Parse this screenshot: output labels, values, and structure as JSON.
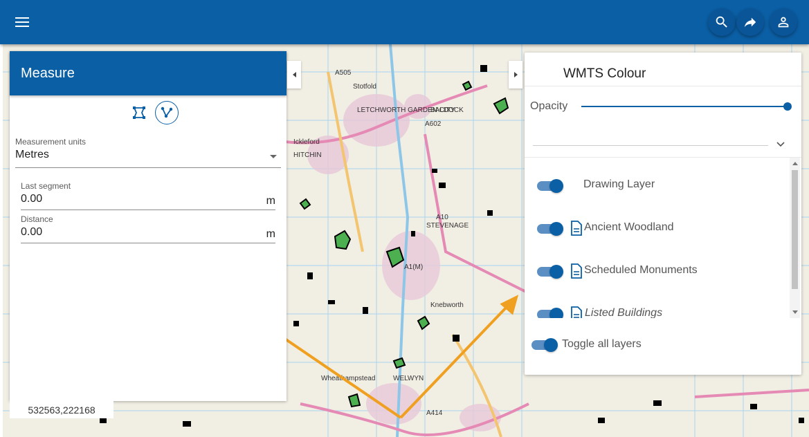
{
  "topbar": {
    "icons": [
      "menu-icon",
      "search-icon",
      "share-icon",
      "account-icon"
    ],
    "bg_color": "#0b5fa5"
  },
  "measure": {
    "title": "Measure",
    "tools": [
      "area-measure-icon",
      "distance-measure-icon"
    ],
    "units_label": "Measurement units",
    "units_value": "Metres",
    "last_segment_label": "Last segment",
    "last_segment_value": "0.00",
    "distance_label": "Distance",
    "distance_value": "0.00",
    "unit_suffix": "m"
  },
  "coordinates": "532563,222168",
  "layers_panel": {
    "title": "WMTS Colour",
    "opacity_label": "Opacity",
    "opacity_value": 1.0,
    "layers": [
      {
        "name": "Drawing Layer",
        "enabled": true,
        "has_doc_icon": false
      },
      {
        "name": "Ancient Woodland",
        "enabled": true,
        "has_doc_icon": true
      },
      {
        "name": "Scheduled Monuments",
        "enabled": true,
        "has_doc_icon": true
      },
      {
        "name": "Listed Buildings",
        "enabled": true,
        "has_doc_icon": true
      }
    ],
    "toggle_all_label": "Toggle all layers"
  },
  "map_labels": [
    "Stotfold",
    "LETCHWORTH GARDEN CITY",
    "BALDOCK",
    "Ickleford",
    "HITCHIN",
    "STEVENAGE",
    "Knebworth",
    "WELWYN",
    "Wheathampstead",
    "A505",
    "A1(M)",
    "A602",
    "A414",
    "A10"
  ],
  "colors": {
    "accent": "#0b5fa5",
    "arrow": "#f0a020",
    "woodland": "#4caf50"
  }
}
